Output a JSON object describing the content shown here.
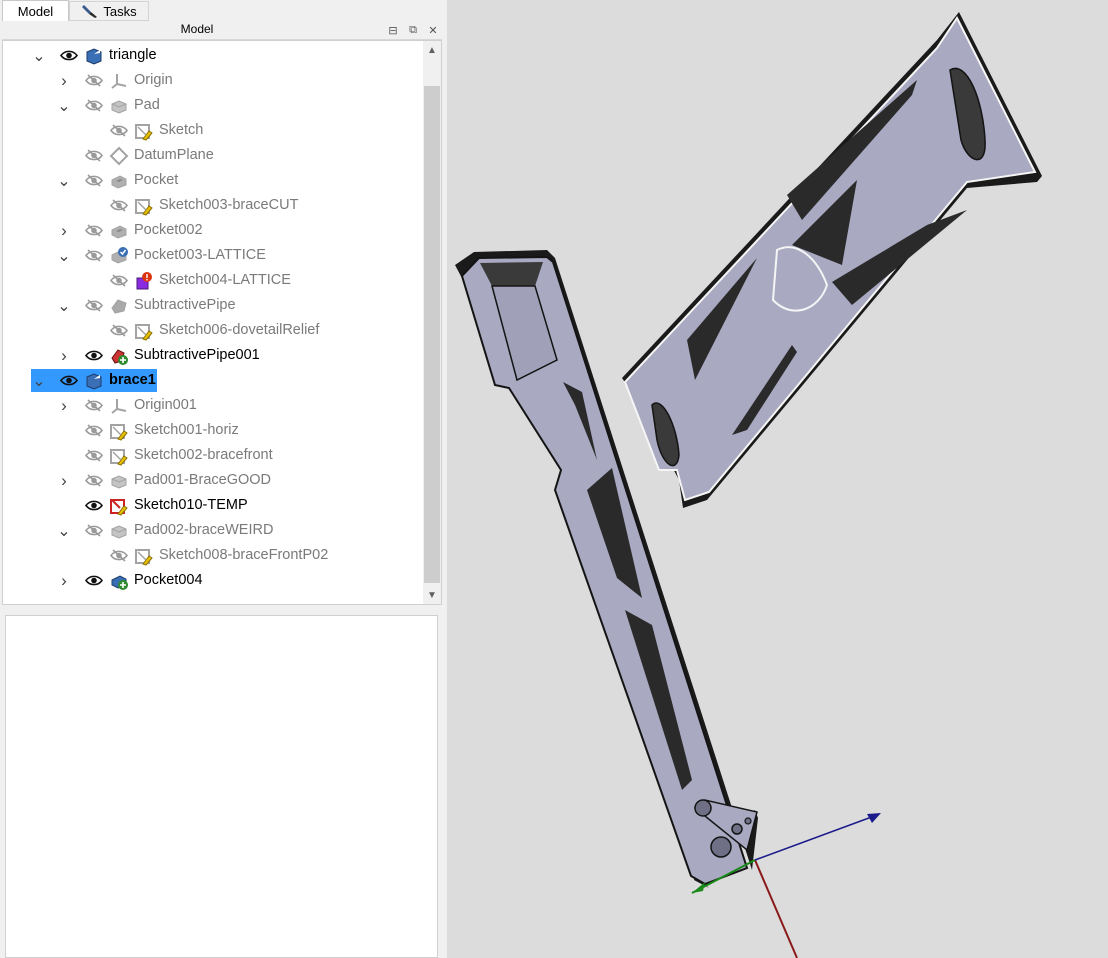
{
  "tabs": {
    "model_label": "Model",
    "tasks_label": "Tasks"
  },
  "dock": {
    "title": "Model",
    "float_glyph": "⧉",
    "restore_glyph": "⊟",
    "close_glyph": "✕"
  },
  "tree": {
    "items": [
      {
        "label": "triangle",
        "state": "visible",
        "icon": "body-icon",
        "expander": "expanded"
      },
      {
        "label": "Origin",
        "state": "hidden",
        "icon": "origin-icon",
        "expander": "collapsed"
      },
      {
        "label": "Pad",
        "state": "hidden",
        "icon": "pad-icon",
        "expander": "expanded"
      },
      {
        "label": "Sketch",
        "state": "hidden",
        "icon": "sketch-icon",
        "expander": "none"
      },
      {
        "label": "DatumPlane",
        "state": "hidden",
        "icon": "datum-plane-icon",
        "expander": "none"
      },
      {
        "label": "Pocket",
        "state": "hidden",
        "icon": "pocket-icon",
        "expander": "expanded"
      },
      {
        "label": "Sketch003-braceCUT",
        "state": "hidden",
        "icon": "sketch-icon",
        "expander": "none"
      },
      {
        "label": "Pocket002",
        "state": "hidden",
        "icon": "pocket-icon",
        "expander": "collapsed"
      },
      {
        "label": "Pocket003-LATTICE",
        "state": "hidden",
        "icon": "pocket-check-icon",
        "expander": "expanded"
      },
      {
        "label": "Sketch004-LATTICE",
        "state": "hidden",
        "icon": "sketch-error-icon",
        "expander": "none"
      },
      {
        "label": "SubtractivePipe",
        "state": "hidden",
        "icon": "subtractive-pipe-icon",
        "expander": "expanded"
      },
      {
        "label": "Sketch006-dovetailRelief",
        "state": "hidden",
        "icon": "sketch-icon",
        "expander": "none"
      },
      {
        "label": "SubtractivePipe001",
        "state": "visible",
        "icon": "subtractive-pipe-tip-icon",
        "expander": "collapsed"
      },
      {
        "label": "brace1",
        "state": "visible-selected",
        "icon": "body-icon",
        "expander": "expanded"
      },
      {
        "label": "Origin001",
        "state": "hidden",
        "icon": "origin-icon",
        "expander": "collapsed"
      },
      {
        "label": "Sketch001-horiz",
        "state": "hidden",
        "icon": "sketch-icon",
        "expander": "none"
      },
      {
        "label": "Sketch002-bracefront",
        "state": "hidden",
        "icon": "sketch-icon",
        "expander": "none"
      },
      {
        "label": "Pad001-BraceGOOD",
        "state": "hidden",
        "icon": "pad-icon",
        "expander": "collapsed"
      },
      {
        "label": "Sketch010-TEMP",
        "state": "visible",
        "icon": "sketch-red-icon",
        "expander": "none"
      },
      {
        "label": "Pad002-braceWEIRD",
        "state": "hidden",
        "icon": "pad-icon",
        "expander": "expanded"
      },
      {
        "label": "Sketch008-braceFrontP02",
        "state": "hidden",
        "icon": "sketch-icon",
        "expander": "none"
      },
      {
        "label": "Pocket004",
        "state": "visible",
        "icon": "pocket-tip-icon",
        "expander": "collapsed"
      }
    ]
  },
  "colors": {
    "selection": "#3399ff",
    "part_face": "#a9a9c2",
    "part_edge": "#141414",
    "background": "#dcdcdc",
    "axis_x": "#8b1a1a",
    "axis_y": "#1a8b1a",
    "axis_z": "#1a1a8b"
  },
  "scroll_icons": {
    "up": "▲",
    "down": "▼"
  }
}
